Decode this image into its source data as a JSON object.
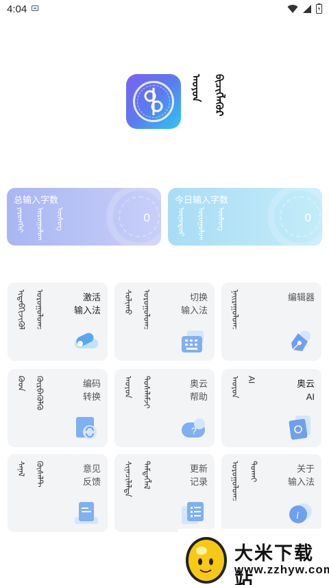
{
  "status_bar": {
    "time": "4:04"
  },
  "app": {
    "name_mongol_1": "ᠠᠣᠶᠤᠨ",
    "name_mongol_2": "ᠪᠢᠴᠢᠭᠯᠡᠭᠦᠷ"
  },
  "stats": {
    "total": {
      "label": "总输入字数",
      "mongol": [
        "ᠶᠡᠷᠦᠩᠬᠡᠢ",
        "ᠣᠷᠤᠭᠤᠯᠤᠭᠰᠠᠨ",
        "ᠦᠰᠦᠭ"
      ],
      "value": "0"
    },
    "today": {
      "label": "今日输入字数",
      "mongol": [
        "ᠥᠨᠥᠳᠥᠷ",
        "ᠣᠷᠤᠭᠤᠯᠤᠭᠰᠠᠨ",
        "ᠦᠰᠦᠭ"
      ],
      "value": "0"
    }
  },
  "menu": [
    {
      "id": "activate",
      "mongol": [
        "ᠢᠳᠡᠪᠬᠢᠵᠢᠭᠦᠯᠬᠦ",
        "ᠣᠷᠤᠭᠤᠯᠤᠭᠴᠢ"
      ],
      "title": [
        "激活",
        "输入法"
      ],
      "icon": "toggle-icon",
      "active": true
    },
    {
      "id": "switch",
      "mongol": [
        "ᠰᠣᠯᠢᠬᠤ",
        "ᠣᠷᠤᠭᠤᠯᠤᠭᠴᠢ"
      ],
      "title": [
        "切换",
        "输入法"
      ],
      "icon": "keyboard-icon",
      "active": false
    },
    {
      "id": "editor",
      "mongol": [
        "ᠨᠠᠢᠷᠠᠭᠤᠯᠤᠭᠴᠢ"
      ],
      "title": [
        "编辑器"
      ],
      "icon": "pen-icon",
      "active": false
    },
    {
      "id": "code-convert",
      "mongol": [
        "ᠺᠣᠳ",
        "ᠬᠥᠷᠪᠡᠭᠦᠯᠬᠦ"
      ],
      "title": [
        "编码",
        "转换"
      ],
      "icon": "convert-icon",
      "active": false
    },
    {
      "id": "help",
      "mongol": [
        "ᠠᠣᠶᠤᠨ",
        "ᠲᠤᠰᠠᠯᠠᠮᠵᠢ"
      ],
      "title": [
        "奥云",
        "帮助"
      ],
      "icon": "help-icon",
      "active": false
    },
    {
      "id": "ai",
      "mongol": [
        "ᠠᠣᠶᠤᠨ",
        "AI"
      ],
      "title": [
        "奥云",
        "AI"
      ],
      "icon": "ai-icon",
      "active": true
    },
    {
      "id": "feedback",
      "mongol": [
        "ᠰᠠᠨᠠᠯ",
        "ᠬᠦᠰᠡᠯᠲ"
      ],
      "title": [
        "意见",
        "反馈"
      ],
      "icon": "feedback-icon",
      "active": false
    },
    {
      "id": "changelog",
      "mongol": [
        "ᠰᠢᠨᠡᠴᠢᠯᠡᠯᠲᠡ",
        "ᠲᠡᠮᠳᠡᠭᠯᠡᠯ"
      ],
      "title": [
        "更新",
        "记录"
      ],
      "icon": "list-icon",
      "active": false
    },
    {
      "id": "about",
      "mongol": [
        "ᠣᠷᠤᠭᠤᠯᠤᠭᠴᠢ",
        "ᠲᠤᠬᠠᠢ"
      ],
      "title": [
        "关于",
        "输入法"
      ],
      "icon": "info-icon",
      "active": false
    }
  ],
  "watermark": {
    "title": "大米下载站",
    "url": "www.zzhyw.com"
  }
}
